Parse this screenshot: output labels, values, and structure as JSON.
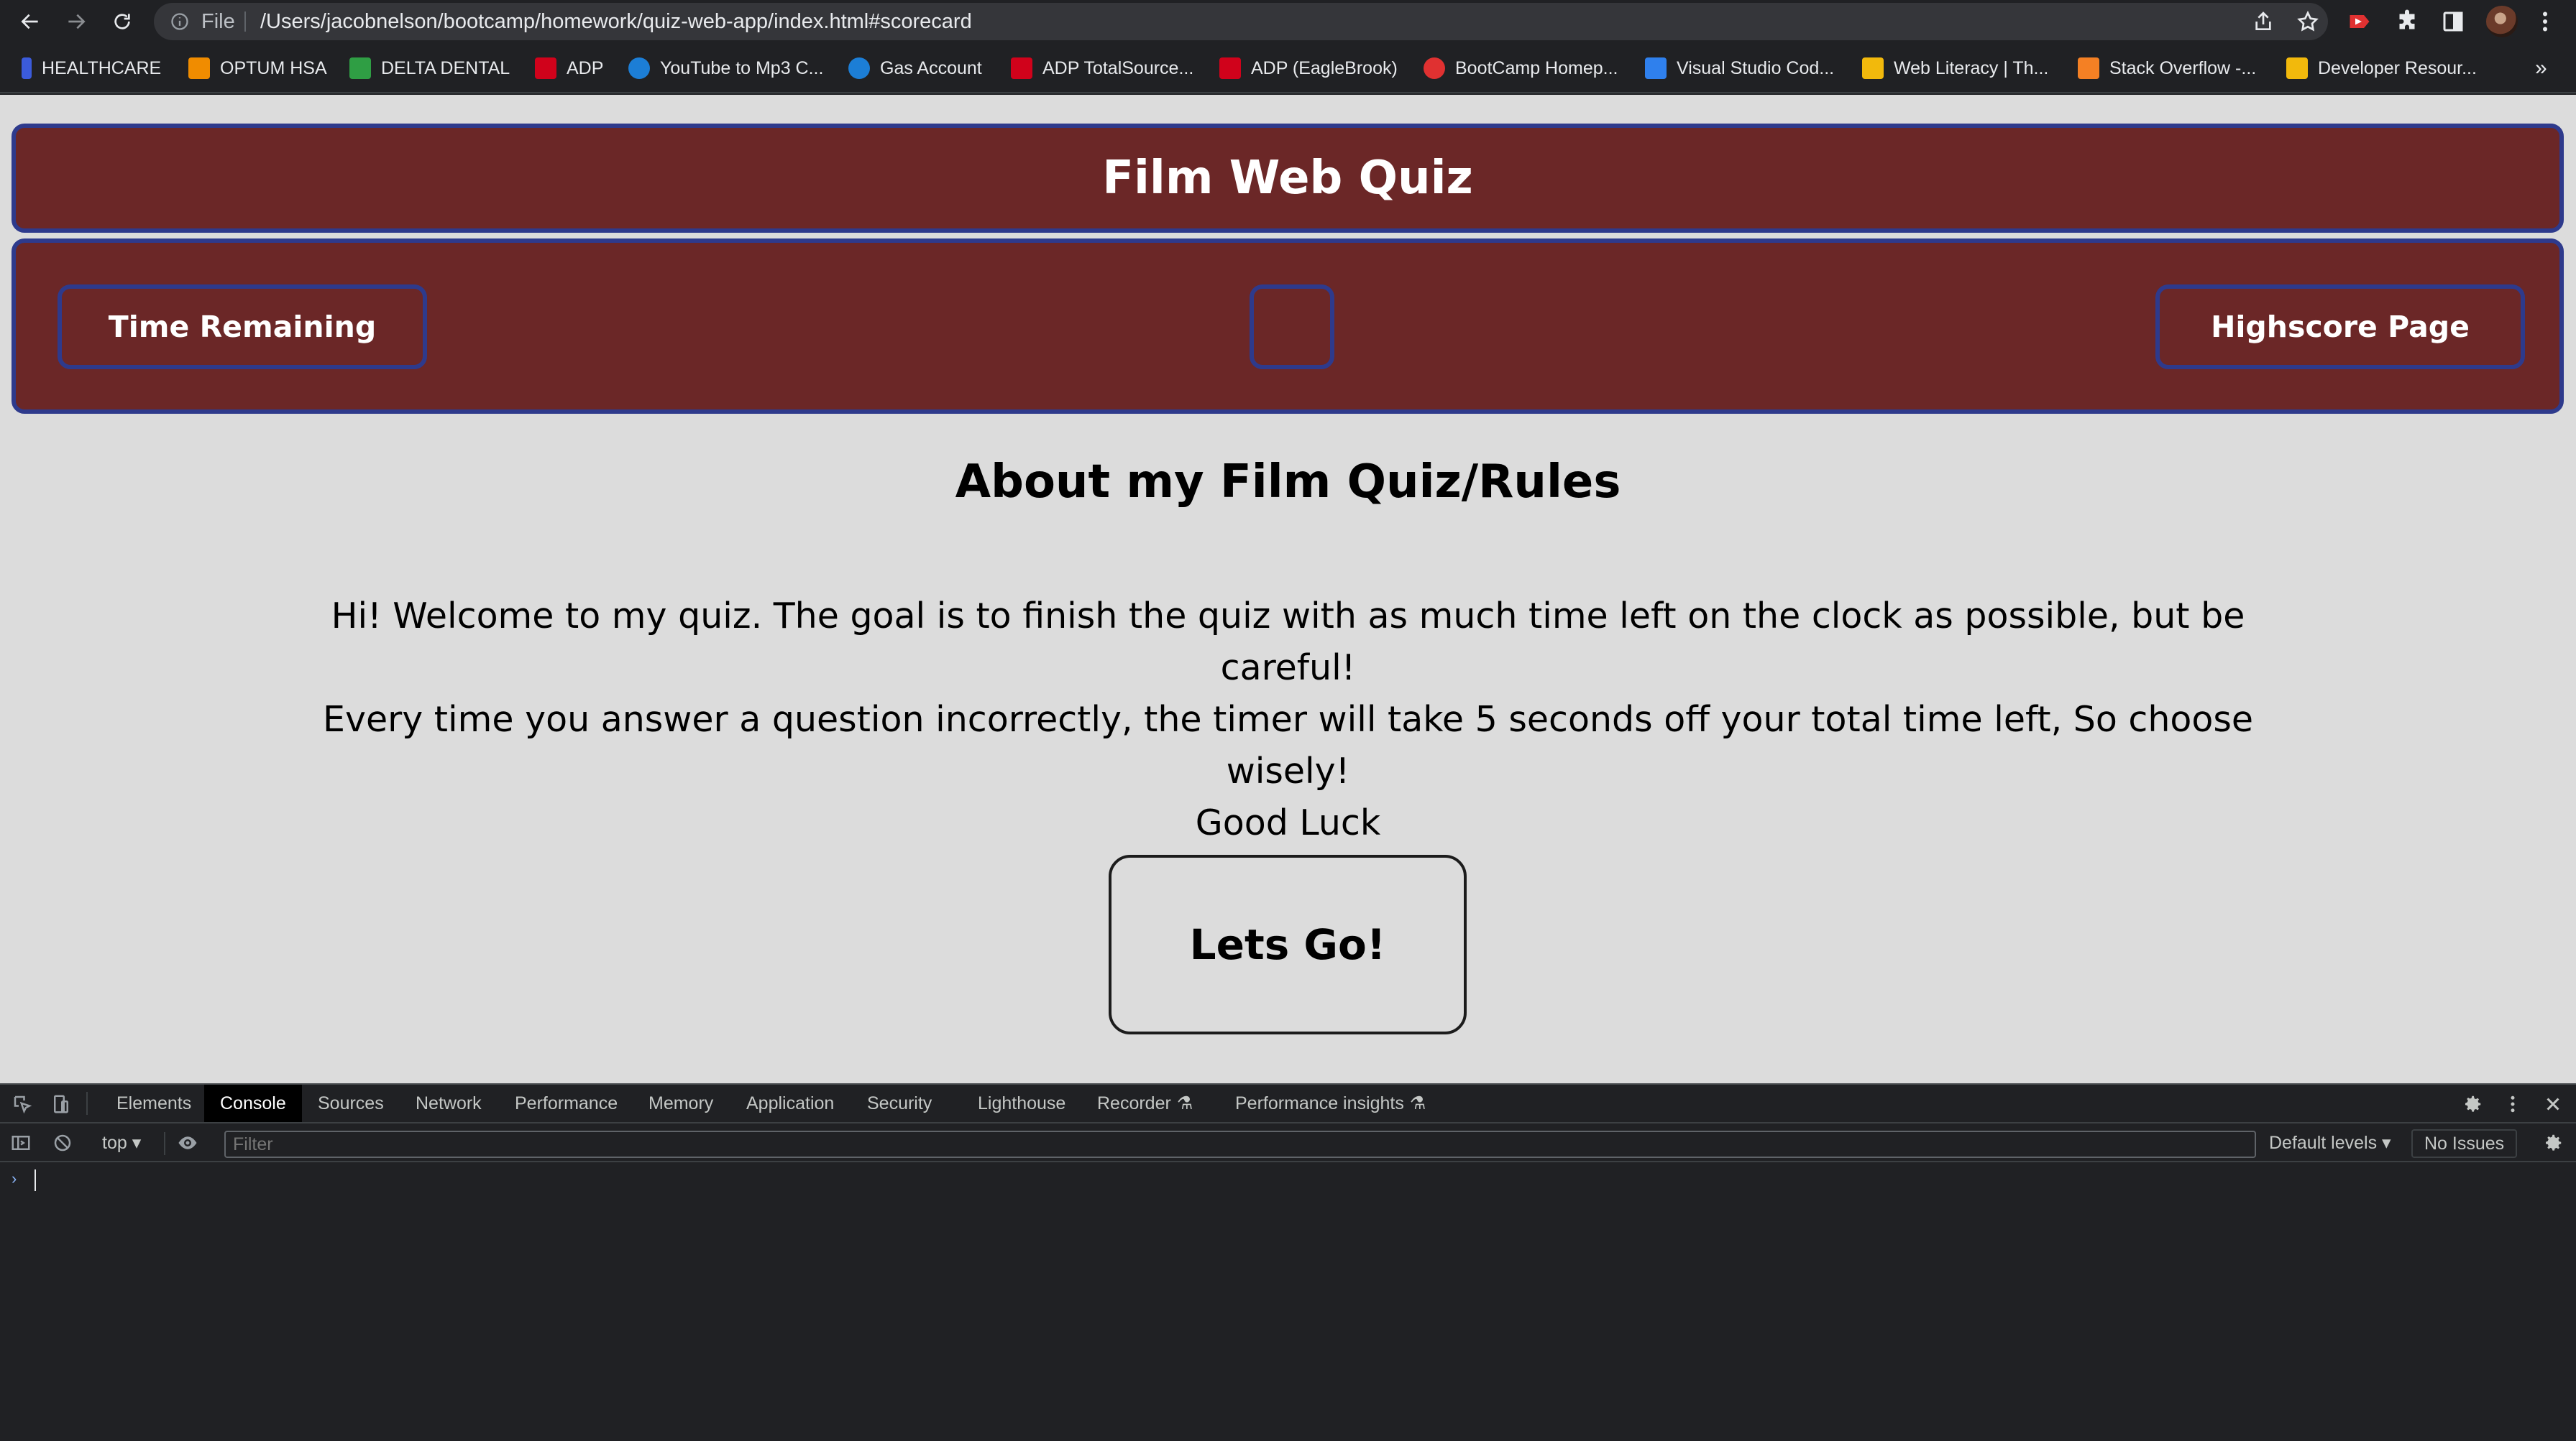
{
  "browser": {
    "file_label": "File",
    "url": "/Users/jacobnelson/bootcamp/homework/quiz-web-app/index.html#scorecard"
  },
  "bookmarks": [
    {
      "label": "HEALTHCARE",
      "color": "#3b5bdb"
    },
    {
      "label": "OPTUM HSA",
      "color": "#f08c00"
    },
    {
      "label": "DELTA DENTAL",
      "color": "#2f9e44"
    },
    {
      "label": "ADP",
      "color": "#d0021b"
    },
    {
      "label": "YouTube to Mp3 C...",
      "color": "#1c7ed6"
    },
    {
      "label": "Gas Account",
      "color": "#1c7ed6"
    },
    {
      "label": "ADP TotalSource...",
      "color": "#d0021b"
    },
    {
      "label": "ADP (EagleBrook)",
      "color": "#d0021b"
    },
    {
      "label": "BootCamp Homep...",
      "color": "#e03131"
    },
    {
      "label": "Visual Studio Cod...",
      "color": "#2f80ed"
    },
    {
      "label": "Web Literacy | Th...",
      "color": "#f2b90c"
    },
    {
      "label": "Stack Overflow -...",
      "color": "#f48024"
    },
    {
      "label": "Developer Resour...",
      "color": "#f2b90c"
    }
  ],
  "page": {
    "title": "Film Web Quiz",
    "time_remaining": "Time Remaining",
    "timer_value": "",
    "highscore": "Highscore Page",
    "about_title": "About my Film Quiz/Rules",
    "rules_line1": "Hi! Welcome to my quiz. The goal is to finish the quiz with as much time left on the clock as possible, but be careful!",
    "rules_line2": "Every time you answer a question incorrectly, the timer will take 5 seconds off your total time left, So choose wisely!",
    "rules_line3": "Good Luck",
    "start_button": "Lets Go!",
    "colors": {
      "header_bg": "#6b2727",
      "border": "#2e3a8c",
      "page_bg": "#dcdcdc"
    }
  },
  "devtools": {
    "tabs": [
      "Elements",
      "Console",
      "Sources",
      "Network",
      "Performance",
      "Memory",
      "Application",
      "Security",
      "Lighthouse",
      "Recorder",
      "Performance insights"
    ],
    "active_tab": "Console",
    "context": "top",
    "filter_placeholder": "Filter",
    "levels": "Default levels",
    "issues": "No Issues"
  }
}
